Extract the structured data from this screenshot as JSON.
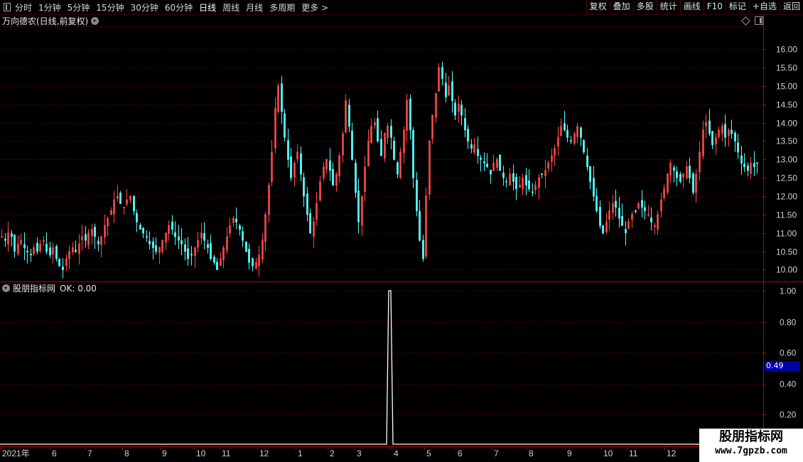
{
  "toolbar": {
    "periods": [
      "分时",
      "1分钟",
      "5分钟",
      "15分钟",
      "30分钟",
      "60分钟",
      "日线",
      "周线",
      "月线",
      "多周期",
      "更多 >"
    ],
    "active_period": "日线",
    "buttons": [
      "复权",
      "叠加",
      "多股",
      "统计",
      "画线",
      "F10",
      "标记",
      "+自选",
      "返回"
    ]
  },
  "main_chart": {
    "title": "万向德农(日线,前复权)",
    "y_ticks": [
      "16.00",
      "15.50",
      "15.00",
      "14.50",
      "14.00",
      "13.50",
      "13.00",
      "12.50",
      "12.00",
      "11.50",
      "11.00",
      "10.50",
      "10.00"
    ]
  },
  "sub_chart": {
    "title": "股朋指标网",
    "ok_label": "OK: 0.00",
    "y_ticks": [
      "1.00",
      "0.80",
      "0.60",
      "0.40",
      "0.20"
    ],
    "cursor_value": "0.49"
  },
  "x_axis": {
    "labels": [
      "2021年",
      "6",
      "7",
      "8",
      "9",
      "10",
      "11",
      "12",
      "1",
      "2",
      "3",
      "4",
      "4",
      "5",
      "6",
      "7",
      "8",
      "9",
      "10",
      "11",
      "12"
    ]
  },
  "watermark": {
    "line1": "股朋指标网",
    "line2": "www.7gpzb.com"
  },
  "colors": {
    "up": "#ff4a4a",
    "down": "#54ffff",
    "grid": "#8b0000",
    "axis": "#c00000",
    "text": "#c8c8c8"
  },
  "chart_data": [
    {
      "type": "candlestick",
      "title": "万向德农(日线,前复权)",
      "ylim": [
        9.7,
        16.6
      ],
      "close": [
        10.9,
        10.8,
        11.0,
        10.9,
        10.5,
        10.7,
        10.8,
        10.6,
        10.5,
        10.4,
        10.6,
        10.5,
        10.7,
        10.8,
        10.5,
        10.4,
        10.6,
        10.3,
        10.1,
        10.0,
        10.3,
        10.5,
        10.6,
        10.5,
        10.7,
        10.9,
        10.8,
        11.0,
        11.1,
        10.9,
        10.7,
        10.9,
        11.2,
        11.4,
        11.6,
        11.9,
        12.0,
        11.8,
        11.7,
        11.9,
        12.0,
        11.6,
        11.3,
        11.1,
        11.0,
        10.9,
        10.7,
        10.6,
        10.5,
        10.6,
        10.8,
        11.0,
        11.2,
        11.1,
        10.9,
        10.8,
        10.7,
        10.5,
        10.3,
        10.4,
        10.6,
        10.8,
        11.0,
        10.8,
        10.6,
        10.3,
        10.2,
        10.0,
        10.3,
        10.6,
        10.9,
        11.2,
        11.4,
        11.3,
        11.1,
        10.8,
        10.5,
        10.2,
        10.1,
        10.2,
        10.4,
        10.8,
        11.5,
        12.3,
        13.2,
        14.4,
        15.0,
        14.3,
        13.6,
        13.0,
        12.5,
        12.9,
        13.2,
        12.6,
        12.0,
        11.5,
        11.0,
        11.3,
        11.8,
        12.4,
        12.8,
        13.0,
        12.7,
        12.3,
        12.6,
        13.1,
        13.7,
        14.6,
        13.9,
        13.0,
        12.1,
        11.3,
        12.0,
        12.8,
        13.5,
        13.9,
        14.0,
        13.5,
        13.1,
        13.7,
        13.9,
        13.6,
        13.0,
        12.6,
        13.2,
        13.8,
        14.6,
        13.8,
        12.5,
        11.6,
        10.8,
        10.3,
        12.0,
        13.5,
        14.2,
        14.8,
        15.5,
        15.2,
        14.7,
        15.0,
        14.6,
        14.2,
        14.5,
        14.2,
        13.8,
        13.5,
        13.3,
        13.4,
        13.1,
        13.0,
        12.9,
        12.8,
        12.6,
        12.9,
        13.0,
        12.7,
        12.5,
        12.4,
        12.6,
        12.4,
        12.2,
        12.3,
        12.5,
        12.3,
        12.2,
        12.1,
        12.3,
        12.5,
        12.6,
        12.7,
        12.9,
        13.1,
        13.3,
        13.6,
        13.9,
        13.8,
        13.6,
        13.5,
        13.7,
        13.9,
        13.6,
        13.2,
        12.8,
        12.4,
        12.0,
        11.6,
        11.2,
        11.0,
        11.3,
        11.6,
        11.8,
        11.7,
        11.4,
        11.2,
        11.0,
        11.3,
        11.5,
        11.6,
        11.8,
        11.7,
        11.6,
        11.5,
        11.3,
        11.2,
        11.5,
        11.9,
        12.2,
        12.6,
        12.9,
        12.7,
        12.5,
        12.4,
        12.6,
        12.8,
        12.5,
        12.1,
        12.6,
        13.2,
        13.8,
        14.0,
        13.7,
        13.4,
        13.6,
        13.8,
        13.9,
        13.6,
        13.8,
        13.7,
        13.5,
        13.2,
        12.9,
        12.8,
        12.7,
        12.9,
        12.8,
        12.9
      ]
    },
    {
      "type": "line",
      "title": "股朋指标网",
      "ylim": [
        0,
        1.05
      ],
      "spike": {
        "level": 1.0,
        "index_fraction": 0.5
      }
    }
  ]
}
